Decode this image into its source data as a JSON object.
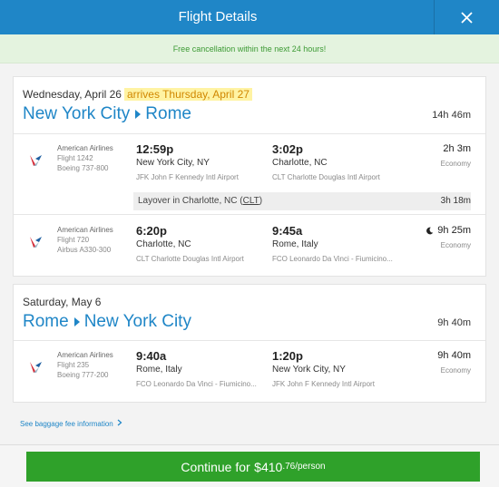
{
  "header": {
    "title": "Flight Details",
    "close_icon": "close-icon"
  },
  "banner": "Free cancellation within the next 24 hours!",
  "outbound": {
    "date": "Wednesday, April 26",
    "arrives": "arrives Thursday, April 27",
    "from": "New York City",
    "to": "Rome",
    "total_duration": "14h 46m",
    "segments": [
      {
        "airline": "American Airlines",
        "flight": "Flight 1242",
        "aircraft": "Boeing 737-800",
        "dep_time": "12:59p",
        "dep_city": "New York City, NY",
        "dep_airport": "JFK John F Kennedy Intl Airport",
        "arr_time": "3:02p",
        "arr_city": "Charlotte, NC",
        "arr_airport": "CLT Charlotte Douglas Intl Airport",
        "duration": "2h 3m",
        "cabin": "Economy",
        "overnight": false
      },
      {
        "airline": "American Airlines",
        "flight": "Flight 720",
        "aircraft": "Airbus A330-300",
        "dep_time": "6:20p",
        "dep_city": "Charlotte, NC",
        "dep_airport": "CLT Charlotte Douglas Intl Airport",
        "arr_time": "9:45a",
        "arr_city": "Rome, Italy",
        "arr_airport": "FCO Leonardo Da Vinci - Fiumicino...",
        "duration": "9h 25m",
        "cabin": "Economy",
        "overnight": true
      }
    ],
    "layover": {
      "prefix": "Layover in Charlotte, NC (",
      "code": "CLT",
      "suffix": ")",
      "duration": "3h 18m"
    }
  },
  "return": {
    "date": "Saturday, May 6",
    "from": "Rome",
    "to": "New York City",
    "total_duration": "9h 40m",
    "segments": [
      {
        "airline": "American Airlines",
        "flight": "Flight 235",
        "aircraft": "Boeing 777-200",
        "dep_time": "9:40a",
        "dep_city": "Rome, Italy",
        "dep_airport": "FCO Leonardo Da Vinci - Fiumicino...",
        "arr_time": "1:20p",
        "arr_city": "New York City, NY",
        "arr_airport": "JFK John F Kennedy Intl Airport",
        "duration": "9h 40m",
        "cabin": "Economy",
        "overnight": false
      }
    ]
  },
  "baggage_link": "See baggage fee information",
  "continue": {
    "prefix": "Continue for ",
    "price_main": "$410",
    "price_cents": ".76",
    "per": "/person"
  },
  "colors": {
    "brand_blue": "#1f86c7",
    "success_green": "#2fa12a",
    "banner_bg": "#e4f3df",
    "highlight": "#fff3a3"
  }
}
